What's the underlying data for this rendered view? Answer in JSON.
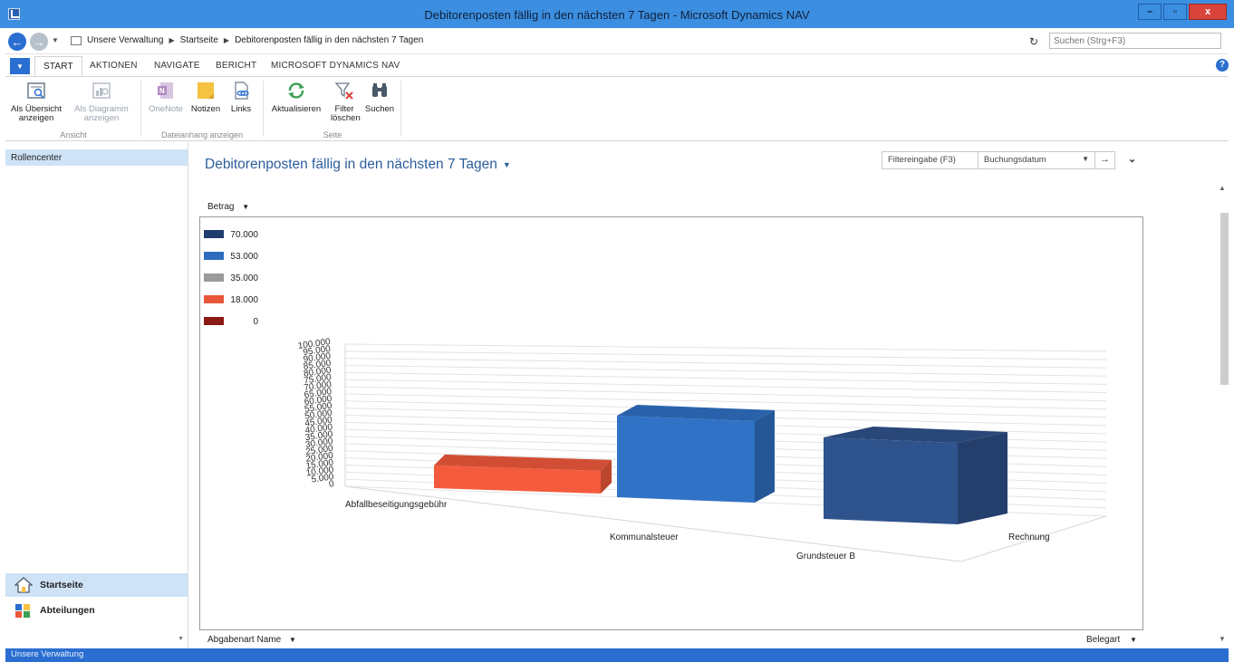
{
  "window": {
    "title": "Debitorenposten fällig in den nächsten 7 Tagen - Microsoft Dynamics NAV",
    "minimize": "–",
    "maximize": "▫",
    "close": "x"
  },
  "address": {
    "crumbs": [
      "Unsere Verwaltung",
      "Startseite",
      "Debitorenposten fällig in den nächsten 7 Tagen"
    ],
    "search_placeholder": "Suchen (Strg+F3)"
  },
  "ribbon": {
    "tabs": [
      "START",
      "AKTIONEN",
      "NAVIGATE",
      "BERICHT",
      "MICROSOFT DYNAMICS NAV"
    ],
    "buttons": {
      "overview": "Als Übersicht anzeigen",
      "diagram": "Als Diagramm anzeigen",
      "onenote": "OneNote",
      "notes": "Notizen",
      "links": "Links",
      "refresh": "Aktualisieren",
      "clear_filter": "Filter löschen",
      "search": "Suchen"
    },
    "groups": {
      "view": "Ansicht",
      "attachments": "Dateianhang anzeigen",
      "page": "Seite"
    }
  },
  "nav": {
    "rolecenter": "Rollencenter",
    "home": "Startseite",
    "departments": "Abteilungen"
  },
  "main": {
    "title": "Debitorenposten fällig in den nächsten 7 Tagen",
    "filter_label": "Filtereingabe (F3)",
    "filter_field": "Buchungsdatum",
    "measure": "Betrag",
    "x_axis": "Abgabenart Name",
    "series_field": "Belegart"
  },
  "status": {
    "text": "Unsere Verwaltung"
  },
  "colors": {
    "accent": "#2a6ed1",
    "title_bar": "#3c8fe0"
  },
  "chart_data": {
    "type": "bar",
    "categories": [
      "Abfallbeseitigungsgebühr",
      "Kommunalsteuer",
      "Grundsteuer B"
    ],
    "series": [
      {
        "name": "Rechnung",
        "values": [
          13000,
          70000,
          70000
        ]
      }
    ],
    "bar_colors": [
      "#e8573a",
      "#2e6dbd",
      "#2d4f86"
    ],
    "legend": {
      "position": "top-left",
      "entries": [
        {
          "label": "70.000",
          "color": "#1f3d6e"
        },
        {
          "label": "53.000",
          "color": "#2e6dbd"
        },
        {
          "label": "35.000",
          "color": "#9a9a9a"
        },
        {
          "label": "18.000",
          "color": "#e8573a"
        },
        {
          "label": "0",
          "color": "#8b1a12"
        }
      ]
    },
    "y_ticks": [
      "100.000",
      "95.000",
      "90.000",
      "85.000",
      "80.000",
      "75.000",
      "70.000",
      "65.000",
      "60.000",
      "55.000",
      "50.000",
      "45.000",
      "40.000",
      "35.000",
      "30.000",
      "25.000",
      "20.000",
      "15.000",
      "10.000",
      "5.000",
      "0"
    ],
    "ylim": [
      0,
      100000
    ],
    "grid": true
  }
}
